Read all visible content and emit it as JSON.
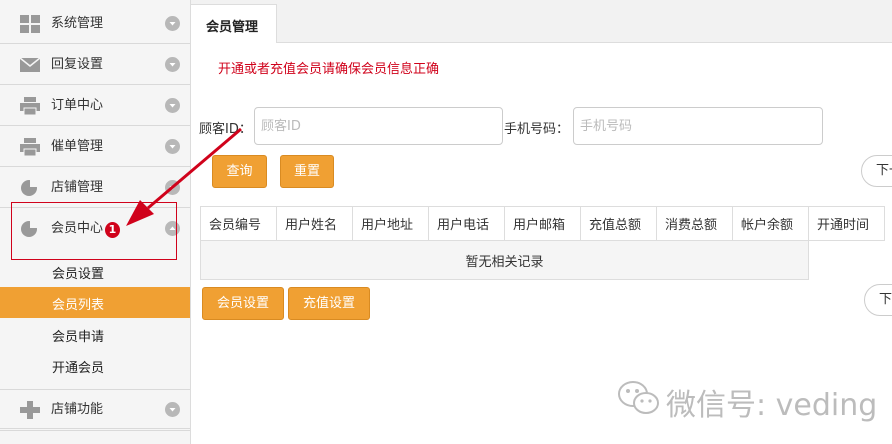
{
  "sidebar": {
    "menus": [
      {
        "label": "系统管理",
        "icon": "grid-icon"
      },
      {
        "label": "回复设置",
        "icon": "mail-icon"
      },
      {
        "label": "订单中心",
        "icon": "printer-icon"
      },
      {
        "label": "催单管理",
        "icon": "printer-icon"
      },
      {
        "label": "店铺管理",
        "icon": "pie-chart-icon"
      },
      {
        "label": "会员中心",
        "icon": "pie-chart-icon"
      }
    ],
    "submenu": [
      {
        "label": "会员设置",
        "active": false
      },
      {
        "label": "会员列表",
        "active": true
      },
      {
        "label": "会员申请",
        "active": false
      },
      {
        "label": "开通会员",
        "active": false
      }
    ],
    "bottom_menu": {
      "label": "店铺功能",
      "icon": "plus-icon"
    }
  },
  "tab": {
    "label": "会员管理"
  },
  "notice": "开通或者充值会员请确保会员信息正确",
  "filters": {
    "customer_id_label": "顾客ID：",
    "customer_id_placeholder": "顾客ID",
    "phone_label": "手机号码：",
    "phone_placeholder": "手机号码",
    "query_button": "查询",
    "reset_button": "重置",
    "next_button": "下一"
  },
  "table": {
    "columns": [
      "会员编号",
      "用户姓名",
      "用户地址",
      "用户电话",
      "用户邮箱",
      "充值总额",
      "消费总额",
      "帐户余额",
      "开通时间"
    ],
    "empty_text": "暂无相关记录"
  },
  "actions": {
    "member_settings_button": "会员设置",
    "recharge_settings_button": "充值设置",
    "next_button": "下"
  },
  "annotation": {
    "badge": "1"
  },
  "watermark": {
    "text": "微信号: veding"
  },
  "colors": {
    "accent": "#f0a033",
    "notice": "#d0021b",
    "annotation": "#d0021b"
  }
}
